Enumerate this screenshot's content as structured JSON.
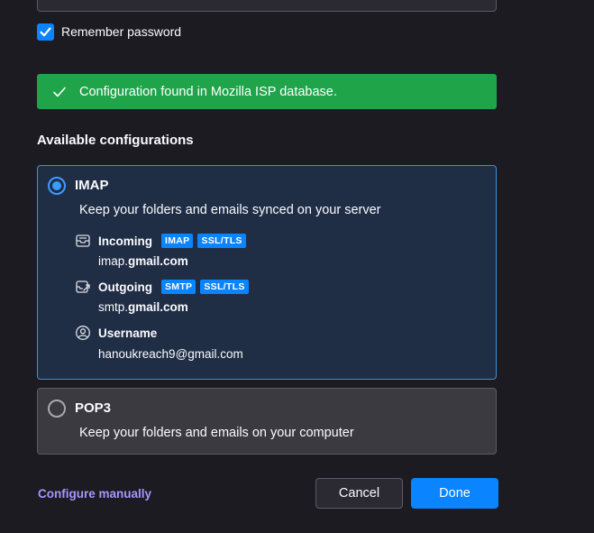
{
  "password": {
    "masked_value": "●●●●●●●●",
    "reveal_icon": "eye-icon"
  },
  "remember": {
    "label": "Remember password",
    "checked": true
  },
  "banner": {
    "icon": "check-icon",
    "text": "Configuration found in Mozilla ISP database.",
    "color": "#1fa44a"
  },
  "available": {
    "heading": "Available configurations"
  },
  "imap": {
    "title": "IMAP",
    "description": "Keep your folders and emails synced on your server",
    "selected": true,
    "incoming": {
      "label": "Incoming",
      "badges": [
        "IMAP",
        "SSL/TLS"
      ],
      "host_prefix": "imap.",
      "host_domain": "gmail.com"
    },
    "outgoing": {
      "label": "Outgoing",
      "badges": [
        "SMTP",
        "SSL/TLS"
      ],
      "host_prefix": "smtp.",
      "host_domain": "gmail.com"
    },
    "username": {
      "label": "Username",
      "value": "hanoukreach9@gmail.com"
    }
  },
  "pop3": {
    "title": "POP3",
    "description": "Keep your folders and emails on your computer",
    "selected": false
  },
  "footer": {
    "configure_manually": "Configure manually",
    "cancel": "Cancel",
    "done": "Done"
  },
  "colors": {
    "accent": "#0a84ff",
    "link": "#a796ff",
    "background": "#1c1b22"
  }
}
